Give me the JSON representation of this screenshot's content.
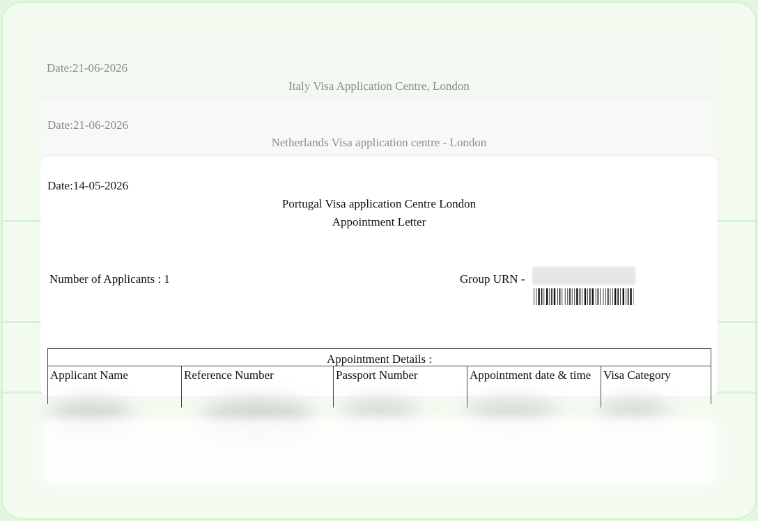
{
  "cards": [
    {
      "date": "Date:21-06-2026",
      "centre": "Italy Visa Application Centre, London"
    },
    {
      "date": "Date:21-06-2026",
      "centre": "Netherlands Visa application centre - London"
    }
  ],
  "letter": {
    "date": "Date:14-05-2026",
    "centre": "Portugal Visa application Centre London",
    "title": "Appointment Letter",
    "applicants": "Number of Applicants : 1",
    "group_urn": "Group URN -",
    "table": {
      "title": "Appointment Details :",
      "headers": [
        "Applicant Name",
        "Reference Number",
        "Passport Number",
        "Appointment date & time",
        "Visa Category"
      ]
    }
  },
  "colors": {
    "background": "#e3f6e0",
    "card": "#ffffff",
    "faded_text": "#8c8c8c",
    "text": "#111111"
  }
}
